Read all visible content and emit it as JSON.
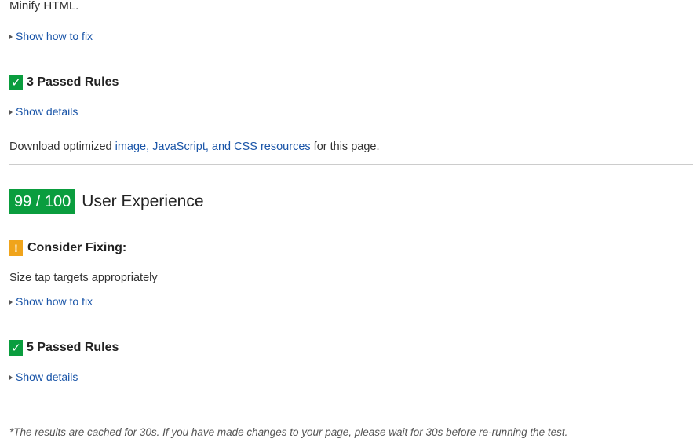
{
  "speed": {
    "cut_rule_text": "Minify HTML.",
    "show_how_to_fix": "Show how to fix",
    "passed": {
      "label": "3 Passed Rules",
      "show_details": "Show details"
    },
    "download": {
      "prefix": "Download optimized ",
      "link": "image, JavaScript, and CSS resources",
      "suffix": " for this page."
    }
  },
  "ux": {
    "score": "99 / 100",
    "title": "User Experience",
    "consider": {
      "label": "Consider Fixing:",
      "rule": "Size tap targets appropriately",
      "show_how_to_fix": "Show how to fix"
    },
    "passed": {
      "label": "5 Passed Rules",
      "show_details": "Show details"
    }
  },
  "footnote": "*The results are cached for 30s. If you have made changes to your page, please wait for 30s before re-running the test.",
  "icons": {
    "check": "✓",
    "warning": "!"
  },
  "colors": {
    "pass_green": "#0a9d3e",
    "warn_orange": "#f0a41b",
    "link_blue": "#1a55a8"
  }
}
